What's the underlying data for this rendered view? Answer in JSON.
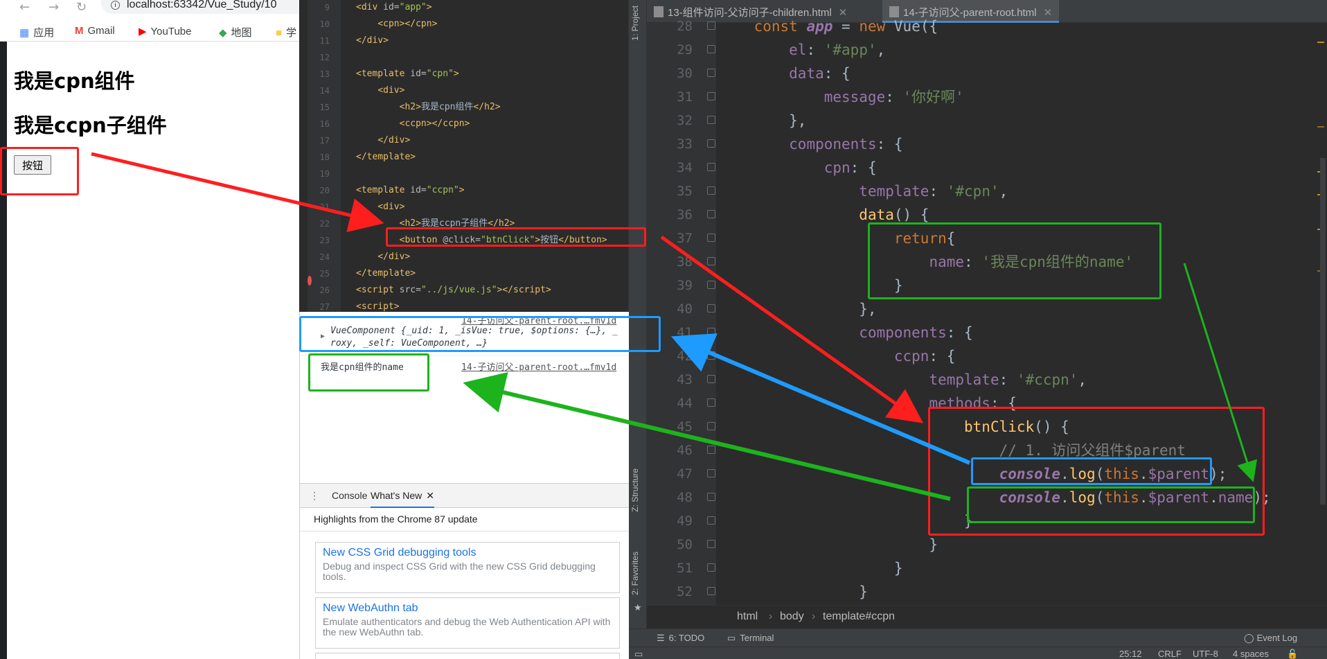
{
  "browser": {
    "address": "localhost:63342/Vue_Study/10",
    "bookmarks": [
      "应用",
      "Gmail",
      "YouTube",
      "地图",
      "学"
    ],
    "page": {
      "heading1": "我是cpn组件",
      "heading2": "我是ccpn子组件",
      "button_label": "按钮"
    }
  },
  "editor_small": {
    "lines": [
      {
        "num": "9",
        "html": "<span class='tag'>&lt;div </span><span class='attr'>id=</span><span class='str'>\"app\"</span><span class='tag'>&gt;</span>"
      },
      {
        "num": "10",
        "html": "    <span class='tag'>&lt;cpn&gt;&lt;/cpn&gt;</span>"
      },
      {
        "num": "11",
        "html": "<span class='tag'>&lt;/div&gt;</span>"
      },
      {
        "num": "12",
        "html": ""
      },
      {
        "num": "13",
        "html": "<span class='tag'>&lt;template </span><span class='attr'>id=</span><span class='str'>\"cpn\"</span><span class='tag'>&gt;</span>"
      },
      {
        "num": "14",
        "html": "    <span class='tag'>&lt;div&gt;</span>"
      },
      {
        "num": "15",
        "html": "        <span class='tag'>&lt;h2&gt;</span><span class='tx'>我是cpn组件</span><span class='tag'>&lt;/h2&gt;</span>"
      },
      {
        "num": "16",
        "html": "        <span class='tag'>&lt;ccpn&gt;&lt;/ccpn&gt;</span>"
      },
      {
        "num": "17",
        "html": "    <span class='tag'>&lt;/div&gt;</span>"
      },
      {
        "num": "18",
        "html": "<span class='tag'>&lt;/template&gt;</span>"
      },
      {
        "num": "19",
        "html": ""
      },
      {
        "num": "20",
        "html": "<span class='tag'>&lt;template </span><span class='attr'>id=</span><span class='str'>\"ccpn\"</span><span class='tag'>&gt;</span>"
      },
      {
        "num": "21",
        "html": "    <span class='tag'>&lt;div&gt;</span>"
      },
      {
        "num": "22",
        "html": "        <span class='tag'>&lt;h2&gt;</span><span class='tx'>我是ccpn子组件</span><span class='tag'>&lt;/h2&gt;</span>"
      },
      {
        "num": "23",
        "html": "        <span class='tag'>&lt;button </span><span class='attr'>@click=</span><span class='str'>\"btnClick\"</span><span class='tag'>&gt;</span><span class='tx'>按钮</span><span class='tag'>&lt;/button&gt;</span>"
      },
      {
        "num": "24",
        "html": "    <span class='tag'>&lt;/div&gt;</span>"
      },
      {
        "num": "25",
        "html": "<span class='tag'>&lt;/template&gt;</span>"
      },
      {
        "num": "26",
        "html": "<span class='tag'>&lt;script </span><span class='attr'>src=</span><span class='str'>\"../js/vue.js\"</span><span class='tag'>&gt;&lt;/script&gt;</span>"
      },
      {
        "num": "27",
        "html": "<span class='tag'>&lt;script&gt;</span>"
      }
    ]
  },
  "console": {
    "vue_component_line1": "VueComponent {_uid: 1, _isVue: true, $options: {…}, _",
    "vue_component_line2": "roxy, _self: VueComponent, …}",
    "name_output": "我是cpn组件的name",
    "source_link": "14-子访问父-parent-root.…fmv1d"
  },
  "devtools_drawer": {
    "tabs": [
      "Console",
      "What's New"
    ],
    "highlight": "Highlights from the Chrome 87 update",
    "cards": [
      {
        "title": "New CSS Grid debugging tools",
        "desc": "Debug and inspect CSS Grid with the new CSS Grid debugging tools."
      },
      {
        "title": "New WebAuthn tab",
        "desc": "Emulate authenticators and debug the Web Authentication API with the new WebAuthn tab."
      }
    ]
  },
  "ide": {
    "tabs": [
      "13-组件访问-父访问子-children.html",
      "14-子访问父-parent-root.html"
    ],
    "side_tabs": [
      "1: Project",
      "Z: Structure",
      "2: Favorites"
    ],
    "lines": [
      {
        "num": "28",
        "html": "    <span class='kw'>const</span> <span class='it'>app</span> = <span class='kw'>new</span> Vue({"
      },
      {
        "num": "29",
        "html": "        <span class='prop'>el</span>: <span class='s'>'#app'</span>,"
      },
      {
        "num": "30",
        "html": "        <span class='prop'>data</span>: {"
      },
      {
        "num": "31",
        "html": "            <span class='prop'>message</span>: <span class='s'>'你好啊'</span>"
      },
      {
        "num": "32",
        "html": "        },"
      },
      {
        "num": "33",
        "html": "        <span class='prop'>components</span>: {"
      },
      {
        "num": "34",
        "html": "            <span class='prop'>cpn</span>: {"
      },
      {
        "num": "35",
        "html": "                <span class='prop'>template</span>: <span class='s'>'#cpn'</span>,"
      },
      {
        "num": "36",
        "html": "                <span class='fn'>data</span>() {"
      },
      {
        "num": "37",
        "html": "                    <span class='kw'>return</span>{"
      },
      {
        "num": "38",
        "html": "                        <span class='prop'>name</span>: <span class='s'>'我是cpn组件的name'</span>"
      },
      {
        "num": "39",
        "html": "                    }"
      },
      {
        "num": "40",
        "html": "                },"
      },
      {
        "num": "41",
        "html": "                <span class='prop'>components</span>: {"
      },
      {
        "num": "42",
        "html": "                    <span class='prop'>ccpn</span>: {"
      },
      {
        "num": "43",
        "html": "                        <span class='prop'>template</span>: <span class='s'>'#ccpn'</span>,"
      },
      {
        "num": "44",
        "html": "                        <span class='prop'>methods</span>: {"
      },
      {
        "num": "45",
        "html": "                            <span class='fn'>btnClick</span>() {"
      },
      {
        "num": "46",
        "html": "                                <span class='cm'>// 1. 访问父组件$parent</span>"
      },
      {
        "num": "47",
        "html": "                                <span class='it'>console</span>.<span class='fn'>log</span>(<span class='kw'>this</span>.<span class='prop'>$parent</span>);"
      },
      {
        "num": "48",
        "html": "                                <span class='it'>console</span>.<span class='fn'>log</span>(<span class='kw'>this</span>.<span class='prop'>$parent</span>.<span class='prop'>name</span>);"
      },
      {
        "num": "49",
        "html": "                            }"
      },
      {
        "num": "50",
        "html": "                        }"
      },
      {
        "num": "51",
        "html": "                    }"
      },
      {
        "num": "52",
        "html": "                }"
      }
    ],
    "breadcrumb": [
      "html",
      "body",
      "template#ccpn"
    ],
    "bottom_tools": [
      "6: TODO",
      "Terminal",
      "Event Log"
    ],
    "status": {
      "position": "25:12",
      "line_sep": "CRLF",
      "encoding": "UTF-8",
      "indent": "4 spaces"
    }
  },
  "colors": {
    "annotation_red": "#ff1e1e",
    "annotation_green": "#1db31d",
    "annotation_blue": "#1e9bff",
    "ide_bg": "#2b2b2b"
  }
}
